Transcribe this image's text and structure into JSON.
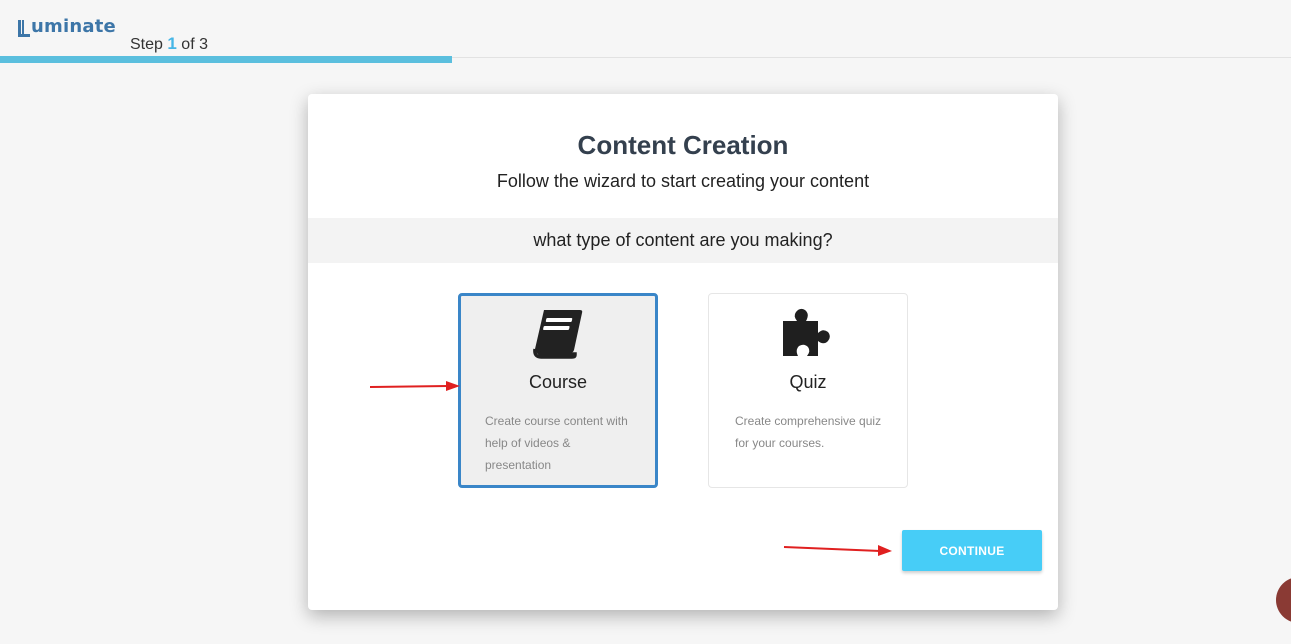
{
  "header": {
    "logo_text": "uminate",
    "logo_letter": "L",
    "step_prefix": "Step",
    "step_current": "1",
    "step_suffix": "of 3",
    "progress_fraction": 0.35,
    "progress_color": "#5bbfde"
  },
  "wizard": {
    "title": "Content Creation",
    "subtitle": "Follow the wizard to start creating your content",
    "question": "what type of content are you making?",
    "options": [
      {
        "title": "Course",
        "description": "Create course content with help of videos & presentation",
        "icon": "book-icon",
        "selected": true
      },
      {
        "title": "Quiz",
        "description": "Create comprehensive quiz for your courses.",
        "icon": "puzzle-piece-icon",
        "selected": false
      }
    ],
    "continue_label": "CONTINUE"
  },
  "colors": {
    "accent": "#47cdf7",
    "selected_border": "#3a86c8",
    "annotation_arrow": "#e02020"
  }
}
